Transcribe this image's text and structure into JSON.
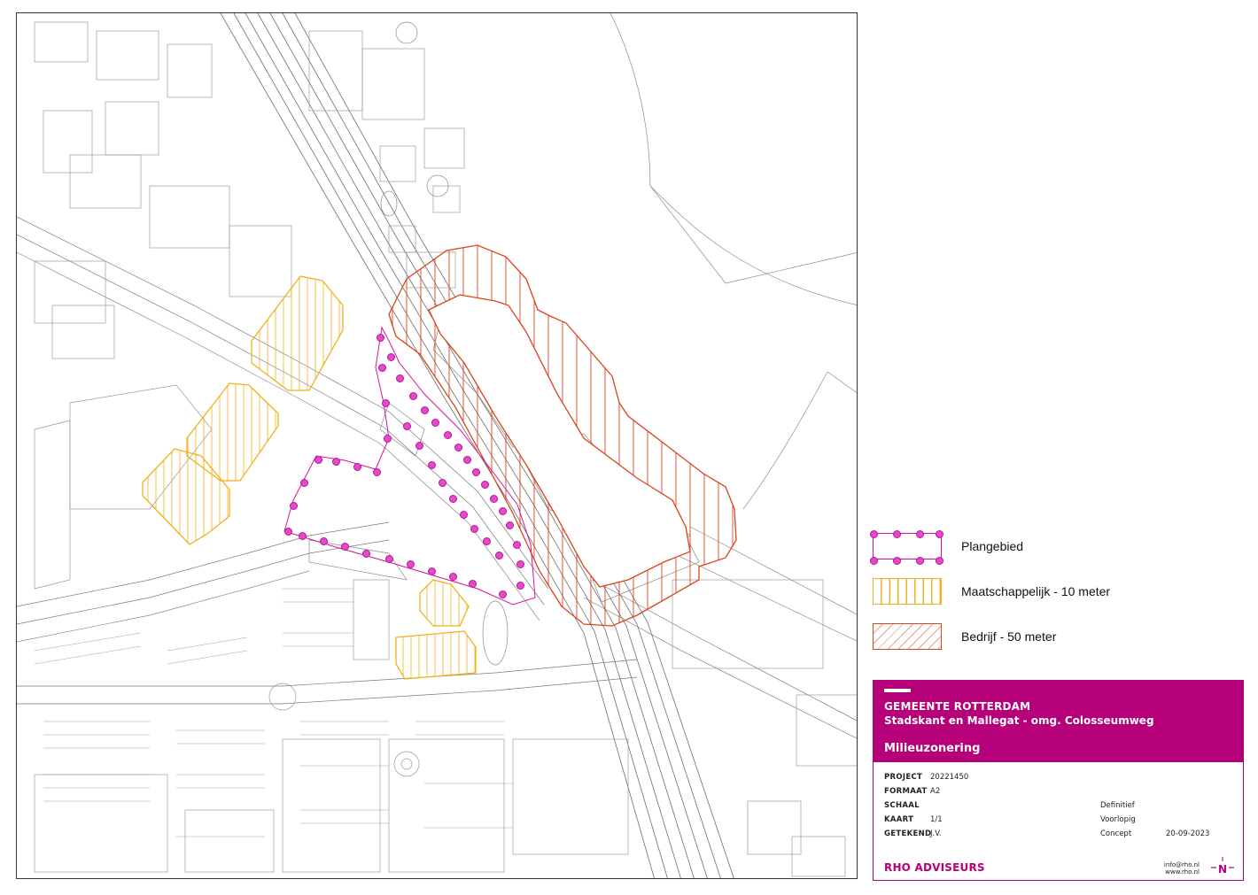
{
  "legend": {
    "items": [
      {
        "label": "Plangebied",
        "color": "#d6149a"
      },
      {
        "label": "Maatschappelijk - 10 meter",
        "color": "#f0b11c"
      },
      {
        "label": "Bedrijf - 50 meter",
        "color": "#d9441c"
      }
    ]
  },
  "titleblock": {
    "organisation": "GEMEENTE ROTTERDAM",
    "subtitle": "Stadskant en Mallegat - omg. Colosseumweg",
    "title": "Milieuzonering",
    "brand_color": "#b5007a",
    "fields": [
      {
        "key": "PROJECT",
        "value": "20221450"
      },
      {
        "key": "FORMAAT",
        "value": "A2"
      },
      {
        "key": "SCHAAL",
        "value": ""
      },
      {
        "key": "KAART",
        "value": "1/1"
      },
      {
        "key": "GETEKEND",
        "value": "J.V."
      }
    ],
    "status": [
      {
        "label": "Definitief",
        "date": ""
      },
      {
        "label": "Voorlopig",
        "date": ""
      },
      {
        "label": "Concept",
        "date": "20-09-2023"
      }
    ],
    "company": "RHO ADVISEURS",
    "email": "info@rho.nl",
    "website": "www.rho.nl",
    "north_label": "N"
  }
}
